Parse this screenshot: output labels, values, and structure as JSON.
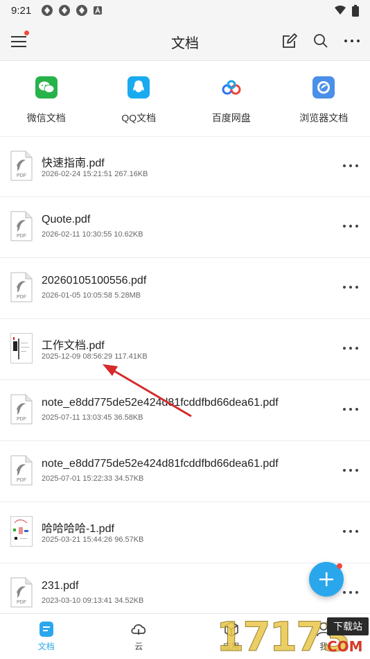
{
  "status_bar": {
    "time": "9:21"
  },
  "header": {
    "title": "文档"
  },
  "sources": [
    {
      "label": "微信文档",
      "icon": "wechat-icon",
      "color": "#27b24a"
    },
    {
      "label": "QQ文档",
      "icon": "qq-icon",
      "color": "#1aaaf0"
    },
    {
      "label": "百度网盘",
      "icon": "baidu-netdisk-icon",
      "color": "#2e73f0"
    },
    {
      "label": "浏览器文档",
      "icon": "browser-icon",
      "color": "#4a8fe8"
    }
  ],
  "files": [
    {
      "name": "快速指南.pdf",
      "meta": "2026-02-24 15:21:51 267.16KB",
      "thumb": "pdf-file-icon"
    },
    {
      "name": "Quote.pdf",
      "meta": "2026-02-11 10:30:55 10.62KB",
      "thumb": "pdf-file-icon"
    },
    {
      "name": "20260105100556.pdf",
      "meta": "2026-01-05 10:05:58 5.28MB",
      "thumb": "pdf-file-icon"
    },
    {
      "name": "工作文档.pdf",
      "meta": "2025-12-09 08:56:29 117.41KB",
      "thumb": "document-preview-thumbnail"
    },
    {
      "name": "note_e8dd775de52e424d81fcddfbd66dea61.pdf",
      "meta": "2025-07-11 13:03:45 36.58KB",
      "thumb": "pdf-file-icon"
    },
    {
      "name": "note_e8dd775de52e424d81fcddfbd66dea61.pdf",
      "meta": "2025-07-01 15:22:33 34.57KB",
      "thumb": "pdf-file-icon"
    },
    {
      "name": "哈哈哈哈-1.pdf",
      "meta": "2025-03-21 15:44:26 96.57KB",
      "thumb": "document-preview-thumbnail"
    },
    {
      "name": "231.pdf",
      "meta": "2023-03-10 09:13:41 34.52KB",
      "thumb": "pdf-file-icon"
    }
  ],
  "pdf_icon_label": "PDF",
  "bottom_nav": [
    {
      "label": "文档",
      "icon": "document-icon",
      "active": true
    },
    {
      "label": "云",
      "icon": "cloud-icon",
      "active": false
    },
    {
      "label": "应用",
      "icon": "apps-cube-icon",
      "active": false
    },
    {
      "label": "我",
      "icon": "profile-icon",
      "active": false
    }
  ],
  "watermark": {
    "digits": "17173",
    "badge": "下载站",
    "suffix": "COM"
  },
  "colors": {
    "accent": "#2aa7ec",
    "badge_red": "#f04a3a",
    "arrow": "#d42a2a"
  }
}
